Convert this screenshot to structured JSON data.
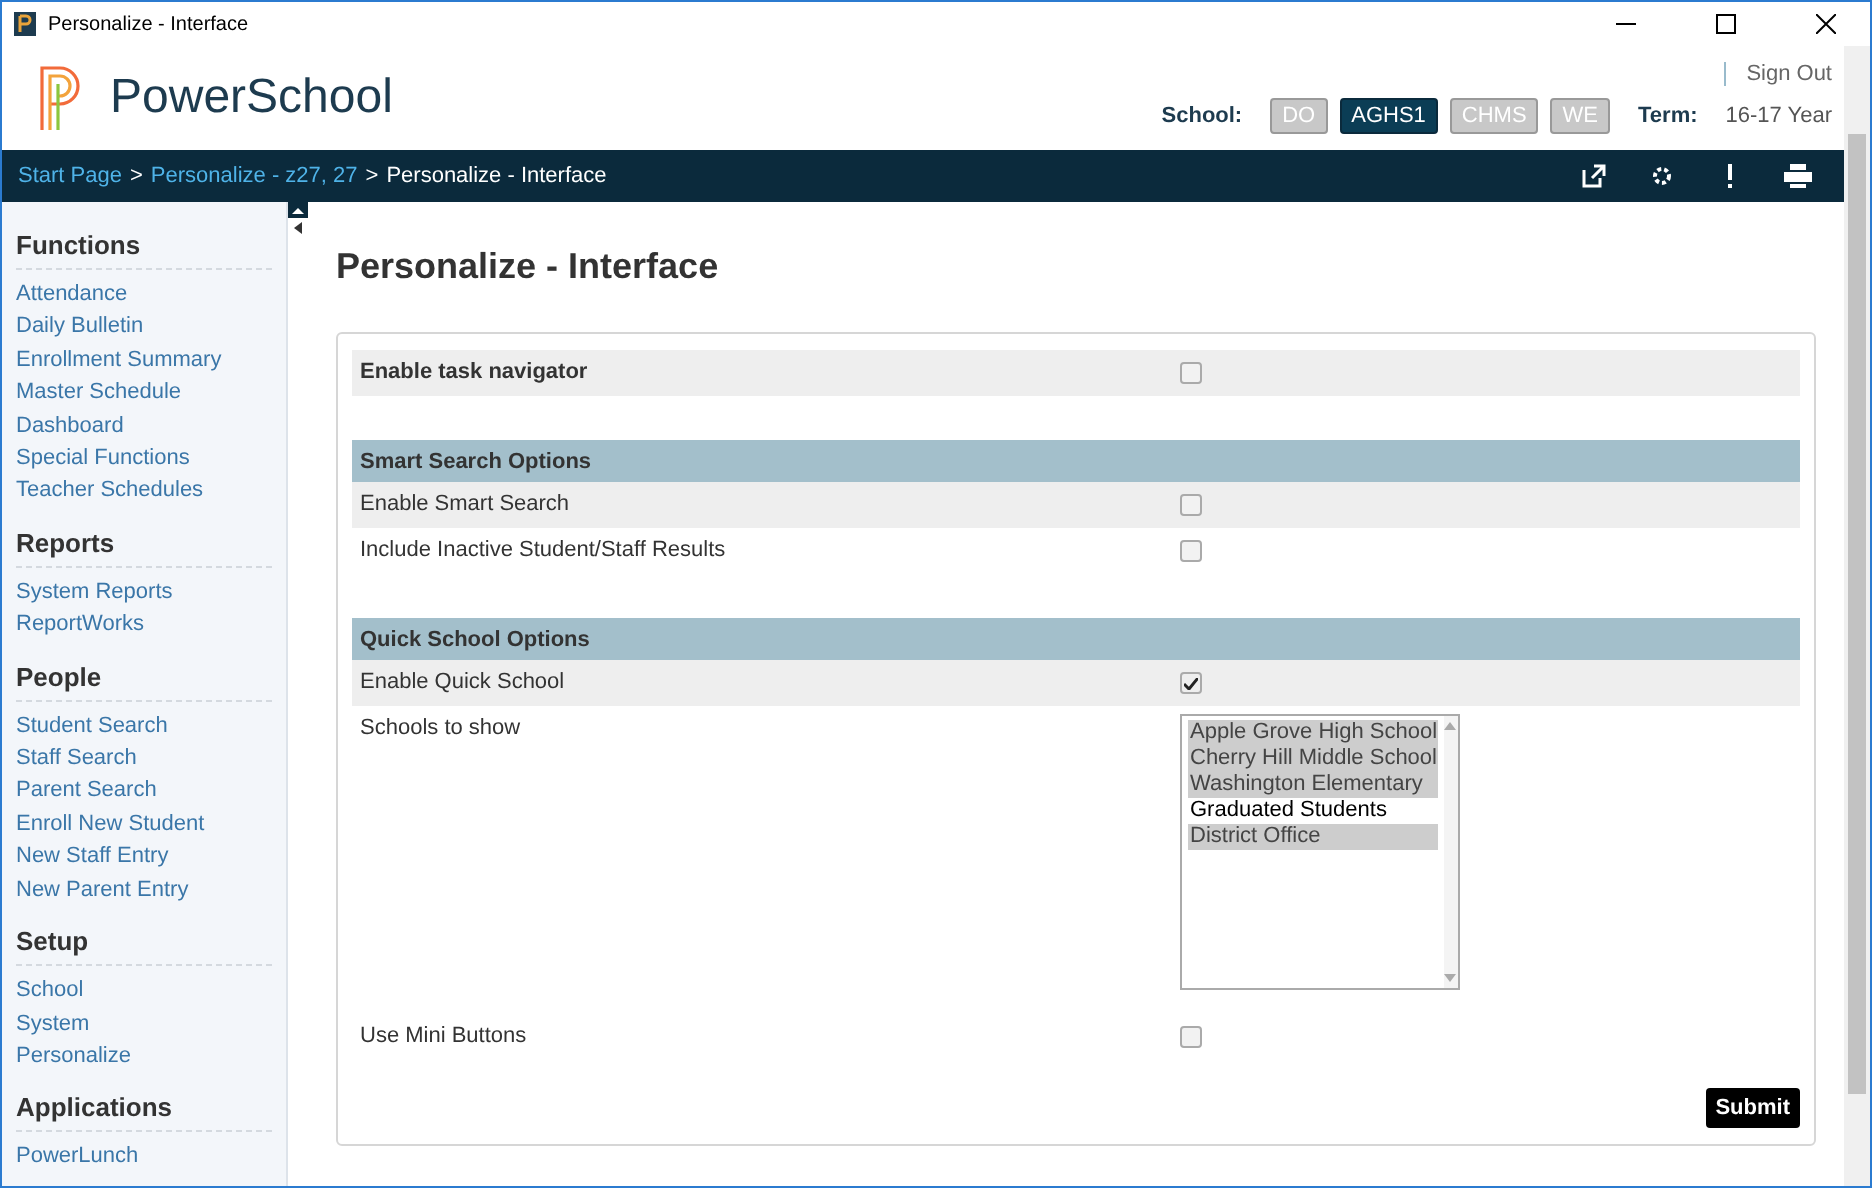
{
  "window": {
    "title": "Personalize - Interface"
  },
  "header": {
    "logo": "PowerSchool",
    "sign_out": "Sign Out",
    "school_label": "School:",
    "schools": [
      {
        "label": "DO",
        "selected": false
      },
      {
        "label": "AGHS1",
        "selected": true
      },
      {
        "label": "CHMS",
        "selected": false
      },
      {
        "label": "WE",
        "selected": false
      }
    ],
    "term_label": "Term:",
    "term": "16-17 Year"
  },
  "breadcrumb": [
    {
      "kind": "link",
      "label": "Start Page"
    },
    {
      "kind": "separator",
      "label": ">"
    },
    {
      "kind": "link",
      "label": "Personalize - z27, 27"
    },
    {
      "kind": "separator",
      "label": ">"
    },
    {
      "kind": "current",
      "label": "Personalize - Interface"
    }
  ],
  "sidebar": [
    {
      "title": "Functions",
      "items": [
        "Attendance",
        "Daily Bulletin",
        "Enrollment Summary",
        "Master Schedule",
        "Dashboard",
        "Special Functions",
        "Teacher Schedules"
      ]
    },
    {
      "title": "Reports",
      "items": [
        "System Reports",
        "ReportWorks"
      ]
    },
    {
      "title": "People",
      "items": [
        "Student Search",
        "Staff Search",
        "Parent Search",
        "Enroll New Student",
        "New Staff Entry",
        "New Parent Entry"
      ]
    },
    {
      "title": "Setup",
      "items": [
        "School",
        "System",
        "Personalize"
      ]
    },
    {
      "title": "Applications",
      "items": [
        "PowerLunch"
      ]
    }
  ],
  "page_title": "Personalize - Interface",
  "groups": [
    {
      "rows": [
        {
          "kind": "checkbox",
          "label": "Enable task navigator",
          "strong": true,
          "checked": false
        }
      ]
    },
    {
      "heading": "Smart Search Options",
      "rows": [
        {
          "kind": "checkbox",
          "label": "Enable Smart Search",
          "checked": false
        },
        {
          "kind": "checkbox",
          "label": "Include Inactive Student/Staff Results",
          "checked": false
        }
      ]
    },
    {
      "heading": "Quick School Options",
      "rows": [
        {
          "kind": "checkbox",
          "label": "Enable Quick School",
          "checked": true
        },
        {
          "kind": "listbox",
          "label": "Schools to show",
          "options": [
            {
              "label": "Apple Grove High School",
              "selected": true
            },
            {
              "label": "Cherry Hill Middle School",
              "selected": true
            },
            {
              "label": "Washington Elementary",
              "selected": true
            },
            {
              "label": "Graduated Students",
              "selected": false
            },
            {
              "label": "District Office",
              "selected": true
            }
          ]
        },
        {
          "kind": "checkbox",
          "label": "Use Mini Buttons",
          "checked": false
        }
      ]
    }
  ],
  "submit": "Submit"
}
